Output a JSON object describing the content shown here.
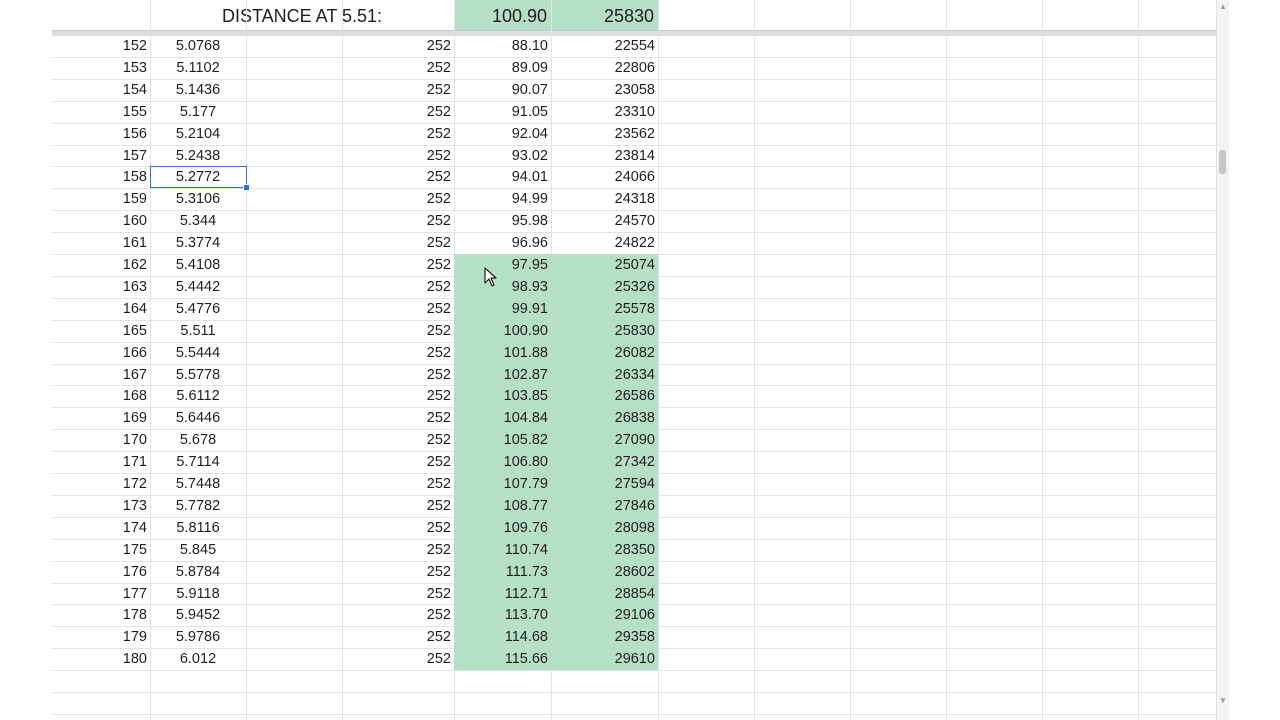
{
  "header": {
    "title": "DISTANCE AT 5.51:",
    "distance_value": "100.90",
    "total_value": "25830",
    "fill_color": "#b5dfc6"
  },
  "rows": [
    {
      "n": "152",
      "val": "5.0768",
      "c": "252",
      "d": "88.10",
      "t": "22554",
      "hl": false
    },
    {
      "n": "153",
      "val": "5.1102",
      "c": "252",
      "d": "89.09",
      "t": "22806",
      "hl": false
    },
    {
      "n": "154",
      "val": "5.1436",
      "c": "252",
      "d": "90.07",
      "t": "23058",
      "hl": false
    },
    {
      "n": "155",
      "val": "5.177",
      "c": "252",
      "d": "91.05",
      "t": "23310",
      "hl": false
    },
    {
      "n": "156",
      "val": "5.2104",
      "c": "252",
      "d": "92.04",
      "t": "23562",
      "hl": false
    },
    {
      "n": "157",
      "val": "5.2438",
      "c": "252",
      "d": "93.02",
      "t": "23814",
      "hl": false
    },
    {
      "n": "158",
      "val": "5.2772",
      "c": "252",
      "d": "94.01",
      "t": "24066",
      "hl": false
    },
    {
      "n": "159",
      "val": "5.3106",
      "c": "252",
      "d": "94.99",
      "t": "24318",
      "hl": false
    },
    {
      "n": "160",
      "val": "5.344",
      "c": "252",
      "d": "95.98",
      "t": "24570",
      "hl": false
    },
    {
      "n": "161",
      "val": "5.3774",
      "c": "252",
      "d": "96.96",
      "t": "24822",
      "hl": false
    },
    {
      "n": "162",
      "val": "5.4108",
      "c": "252",
      "d": "97.95",
      "t": "25074",
      "hl": true
    },
    {
      "n": "163",
      "val": "5.4442",
      "c": "252",
      "d": "98.93",
      "t": "25326",
      "hl": true
    },
    {
      "n": "164",
      "val": "5.4776",
      "c": "252",
      "d": "99.91",
      "t": "25578",
      "hl": true
    },
    {
      "n": "165",
      "val": "5.511",
      "c": "252",
      "d": "100.90",
      "t": "25830",
      "hl": true
    },
    {
      "n": "166",
      "val": "5.5444",
      "c": "252",
      "d": "101.88",
      "t": "26082",
      "hl": true
    },
    {
      "n": "167",
      "val": "5.5778",
      "c": "252",
      "d": "102.87",
      "t": "26334",
      "hl": true
    },
    {
      "n": "168",
      "val": "5.6112",
      "c": "252",
      "d": "103.85",
      "t": "26586",
      "hl": true
    },
    {
      "n": "169",
      "val": "5.6446",
      "c": "252",
      "d": "104.84",
      "t": "26838",
      "hl": true
    },
    {
      "n": "170",
      "val": "5.678",
      "c": "252",
      "d": "105.82",
      "t": "27090",
      "hl": true
    },
    {
      "n": "171",
      "val": "5.7114",
      "c": "252",
      "d": "106.80",
      "t": "27342",
      "hl": true
    },
    {
      "n": "172",
      "val": "5.7448",
      "c": "252",
      "d": "107.79",
      "t": "27594",
      "hl": true
    },
    {
      "n": "173",
      "val": "5.7782",
      "c": "252",
      "d": "108.77",
      "t": "27846",
      "hl": true
    },
    {
      "n": "174",
      "val": "5.8116",
      "c": "252",
      "d": "109.76",
      "t": "28098",
      "hl": true
    },
    {
      "n": "175",
      "val": "5.845",
      "c": "252",
      "d": "110.74",
      "t": "28350",
      "hl": true
    },
    {
      "n": "176",
      "val": "5.8784",
      "c": "252",
      "d": "111.73",
      "t": "28602",
      "hl": true
    },
    {
      "n": "177",
      "val": "5.9118",
      "c": "252",
      "d": "112.71",
      "t": "28854",
      "hl": true
    },
    {
      "n": "178",
      "val": "5.9452",
      "c": "252",
      "d": "113.70",
      "t": "29106",
      "hl": true
    },
    {
      "n": "179",
      "val": "5.9786",
      "c": "252",
      "d": "114.68",
      "t": "29358",
      "hl": true
    },
    {
      "n": "180",
      "val": "6.012",
      "c": "252",
      "d": "115.66",
      "t": "29610",
      "hl": true
    }
  ],
  "selected_cell_value": "5.2772",
  "icons": {
    "cursor": "mouse-pointer-icon",
    "scroll_up": "scroll-up-arrow-icon",
    "scroll_down": "scroll-down-arrow-icon"
  }
}
